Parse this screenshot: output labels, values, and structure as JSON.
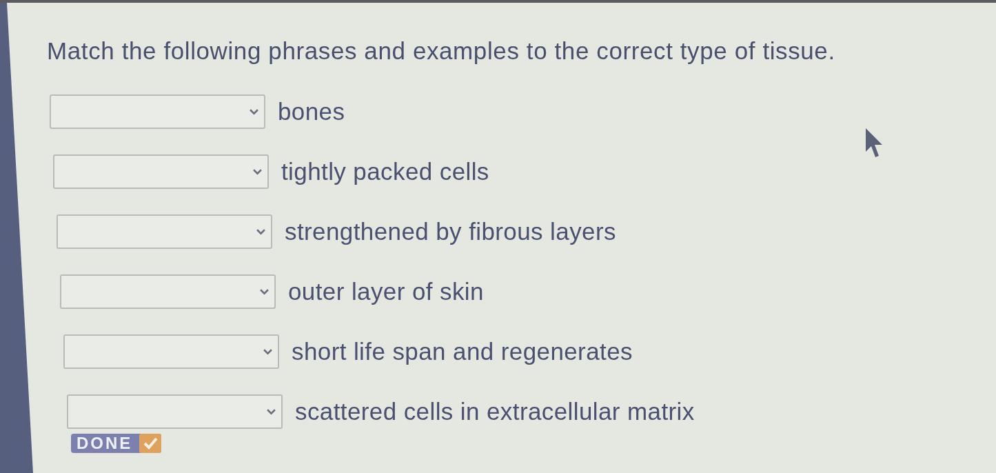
{
  "question": {
    "prompt": "Match the following phrases and examples to the correct type of tissue."
  },
  "matches": [
    {
      "phrase": "bones"
    },
    {
      "phrase": "tightly packed cells"
    },
    {
      "phrase": "strengthened by fibrous layers"
    },
    {
      "phrase": "outer layer of skin"
    },
    {
      "phrase": "short life span and regenerates"
    },
    {
      "phrase": "scattered cells in extracellular matrix"
    }
  ],
  "done_button": {
    "label": "DONE"
  }
}
